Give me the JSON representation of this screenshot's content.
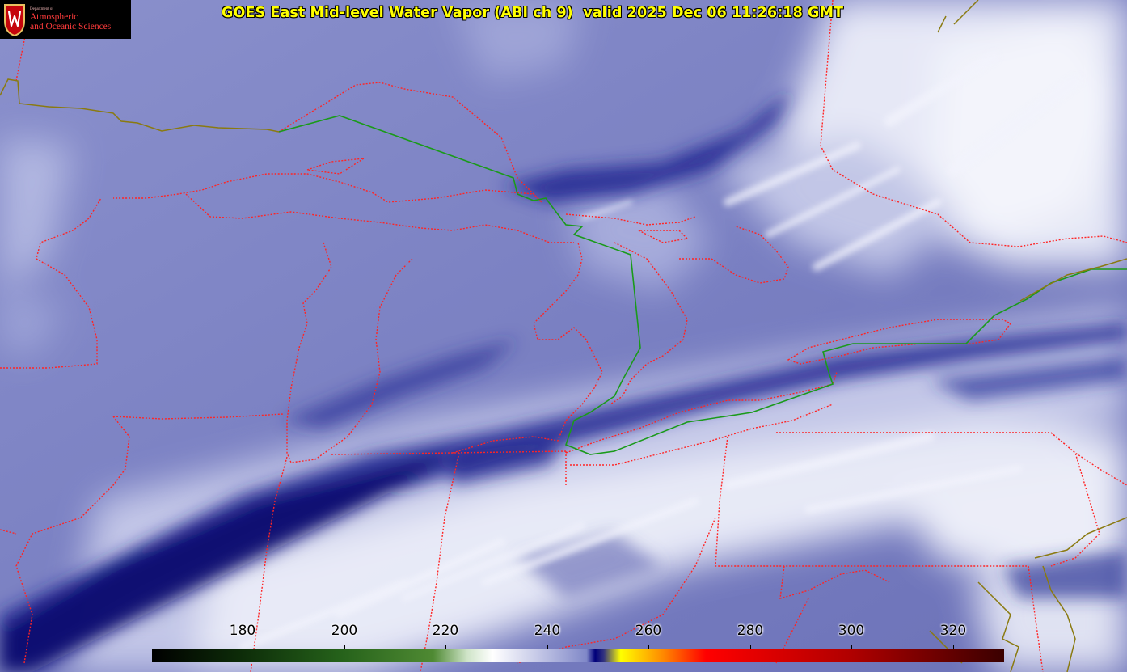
{
  "title": "GOES East Mid-level Water Vapor (ABI ch 9)  valid 2025 Dec 06 11:26:18 GMT",
  "logo": {
    "dept": "Department of",
    "line1": "Atmospheric",
    "line2": "and Oceanic Sciences"
  },
  "colorbar": {
    "ticks": [
      "180",
      "200",
      "220",
      "240",
      "260",
      "280",
      "300",
      "320"
    ],
    "min": 162,
    "max": 330
  },
  "colors": {
    "background": "#7f84c4",
    "dry_band": "#0a1170",
    "cloud": "#eef0fa",
    "state_border": "#ff2020",
    "intl_border": "#1a9a1a",
    "coast": "#7a7a10",
    "title": "#ffff00"
  },
  "icons": [
    "uw-seal-icon"
  ]
}
